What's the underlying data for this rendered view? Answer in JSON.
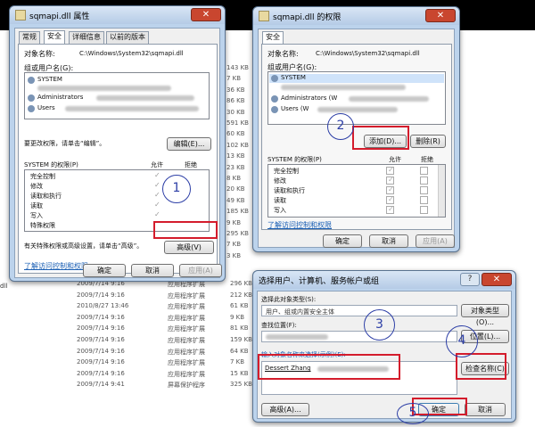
{
  "explorer": {
    "sizes": [
      "143 KB",
      "7 KB",
      "36 KB",
      "86 KB",
      "30 KB",
      "591 KB",
      "60 KB",
      "102 KB",
      "13 KB",
      "23 KB",
      "8 KB",
      "20 KB",
      "49 KB",
      "185 KB",
      "9 KB",
      "295 KB",
      "7 KB",
      "3 KB"
    ],
    "rows": [
      {
        "date": "2009/7/14 9:16",
        "type": "应用程序扩展",
        "size": "296 KB"
      },
      {
        "date": "2009/7/14 9:16",
        "type": "应用程序扩展",
        "size": "212 KB"
      },
      {
        "date": "2010/8/27 13:46",
        "type": "应用程序扩展",
        "size": "61 KB"
      },
      {
        "date": "2009/7/14 9:16",
        "type": "应用程序扩展",
        "size": "9 KB"
      },
      {
        "date": "2009/7/14 9:16",
        "type": "应用程序扩展",
        "size": "81 KB"
      },
      {
        "date": "2009/7/14 9:16",
        "type": "应用程序扩展",
        "size": "159 KB"
      },
      {
        "date": "2009/7/14 9:16",
        "type": "应用程序扩展",
        "size": "64 KB"
      },
      {
        "date": "2009/7/14 9:16",
        "type": "应用程序扩展",
        "size": "7 KB"
      },
      {
        "date": "2009/7/14 9:16",
        "type": "应用程序扩展",
        "size": "15 KB"
      },
      {
        "date": "2009/7/14 9:41",
        "type": "屏幕保护程序",
        "size": "325 KB"
      }
    ],
    "left_fragment": "dll"
  },
  "props": {
    "title": "sqmapi.dll 属性",
    "tabs": [
      "常规",
      "安全",
      "详细信息",
      "以前的版本"
    ],
    "object_label": "对象名称:",
    "object_value": "C:\\Windows\\System32\\sqmapi.dll",
    "group_label": "组或用户名(G):",
    "users": [
      "SYSTEM",
      "Administrators",
      "Users"
    ],
    "change_text": "要更改权限，请单击“编辑”。",
    "edit_btn": "编辑(E)...",
    "perm_header": "SYSTEM 的权限(P)",
    "allow": "允许",
    "deny": "拒绝",
    "perms": [
      "完全控制",
      "修改",
      "读取和执行",
      "读取",
      "写入",
      "特殊权限"
    ],
    "special_text": "有关特殊权限或高级设置，请单击“高级”。",
    "advanced_btn": "高级(V)",
    "learn_link": "了解访问控制和权限",
    "ok": "确定",
    "cancel": "取消",
    "apply": "应用(A)"
  },
  "perm_dialog": {
    "title": "sqmapi.dll 的权限",
    "tab": "安全",
    "object_label": "对象名称:",
    "object_value": "C:\\Windows\\System32\\sqmapi.dll",
    "group_label": "组或用户名(G):",
    "users": [
      "SYSTEM",
      "Administrators (W",
      "Users (W"
    ],
    "add_btn": "添加(D)...",
    "remove_btn": "删除(R)",
    "perm_header": "SYSTEM 的权限(P)",
    "allow": "允许",
    "deny": "拒绝",
    "perms": [
      "完全控制",
      "修改",
      "读取和执行",
      "读取",
      "写入"
    ],
    "learn_link": "了解访问控制和权限",
    "ok": "确定",
    "cancel": "取消",
    "apply": "应用(A)"
  },
  "select_dialog": {
    "title": "选择用户、计算机、服务帐户或组",
    "type_label": "选择此对象类型(S):",
    "type_value": "用户、组或内置安全主体",
    "type_btn": "对象类型(O)...",
    "loc_label": "查找位置(F):",
    "loc_btn": "位置(L)...",
    "names_label": "输入对象名称来选择(示例)(E):",
    "names_value": "Dessert Zhang",
    "check_btn": "检查名称(C)",
    "advanced_btn": "高级(A)...",
    "ok": "确定",
    "cancel": "取消"
  },
  "annotations": [
    "1",
    "2",
    "3",
    "4",
    "5"
  ],
  "colors": {
    "annotation": "#2c3ea6",
    "highlight": "#d41c2c",
    "link": "#1a5fb4"
  }
}
